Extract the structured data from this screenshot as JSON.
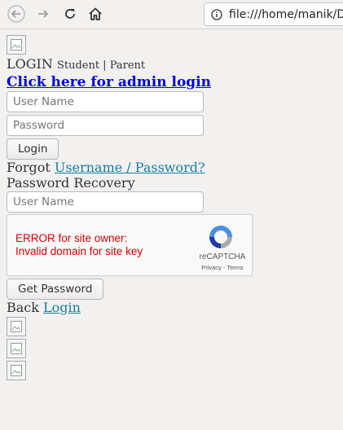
{
  "browser": {
    "url": "file:///home/manik/D",
    "back_icon": "back-arrow-icon",
    "forward_icon": "forward-arrow-icon",
    "reload_icon": "reload-icon",
    "home_icon": "home-icon"
  },
  "login": {
    "title": "LOGIN",
    "roles": "Student | Parent",
    "admin_link": "Click here for admin login",
    "username_placeholder": "User Name",
    "password_placeholder": "Password",
    "login_button": "Login",
    "forgot_prefix": "Forgot",
    "forgot_link": "Username / Password?"
  },
  "recovery": {
    "title": "Password Recovery",
    "username_placeholder": "User Name",
    "captcha_error_line1": "ERROR for site owner:",
    "captcha_error_line2": "Invalid domain for site key",
    "captcha_brand": "reCAPTCHA",
    "captcha_terms": "Privacy - Terms",
    "get_password_button": "Get Password",
    "back_prefix": "Back",
    "back_link": "Login"
  },
  "colors": {
    "link_admin": "#0000ee",
    "link": "#167fa0",
    "captcha_error": "#d40000",
    "page_bg": "#f2f1f0"
  }
}
